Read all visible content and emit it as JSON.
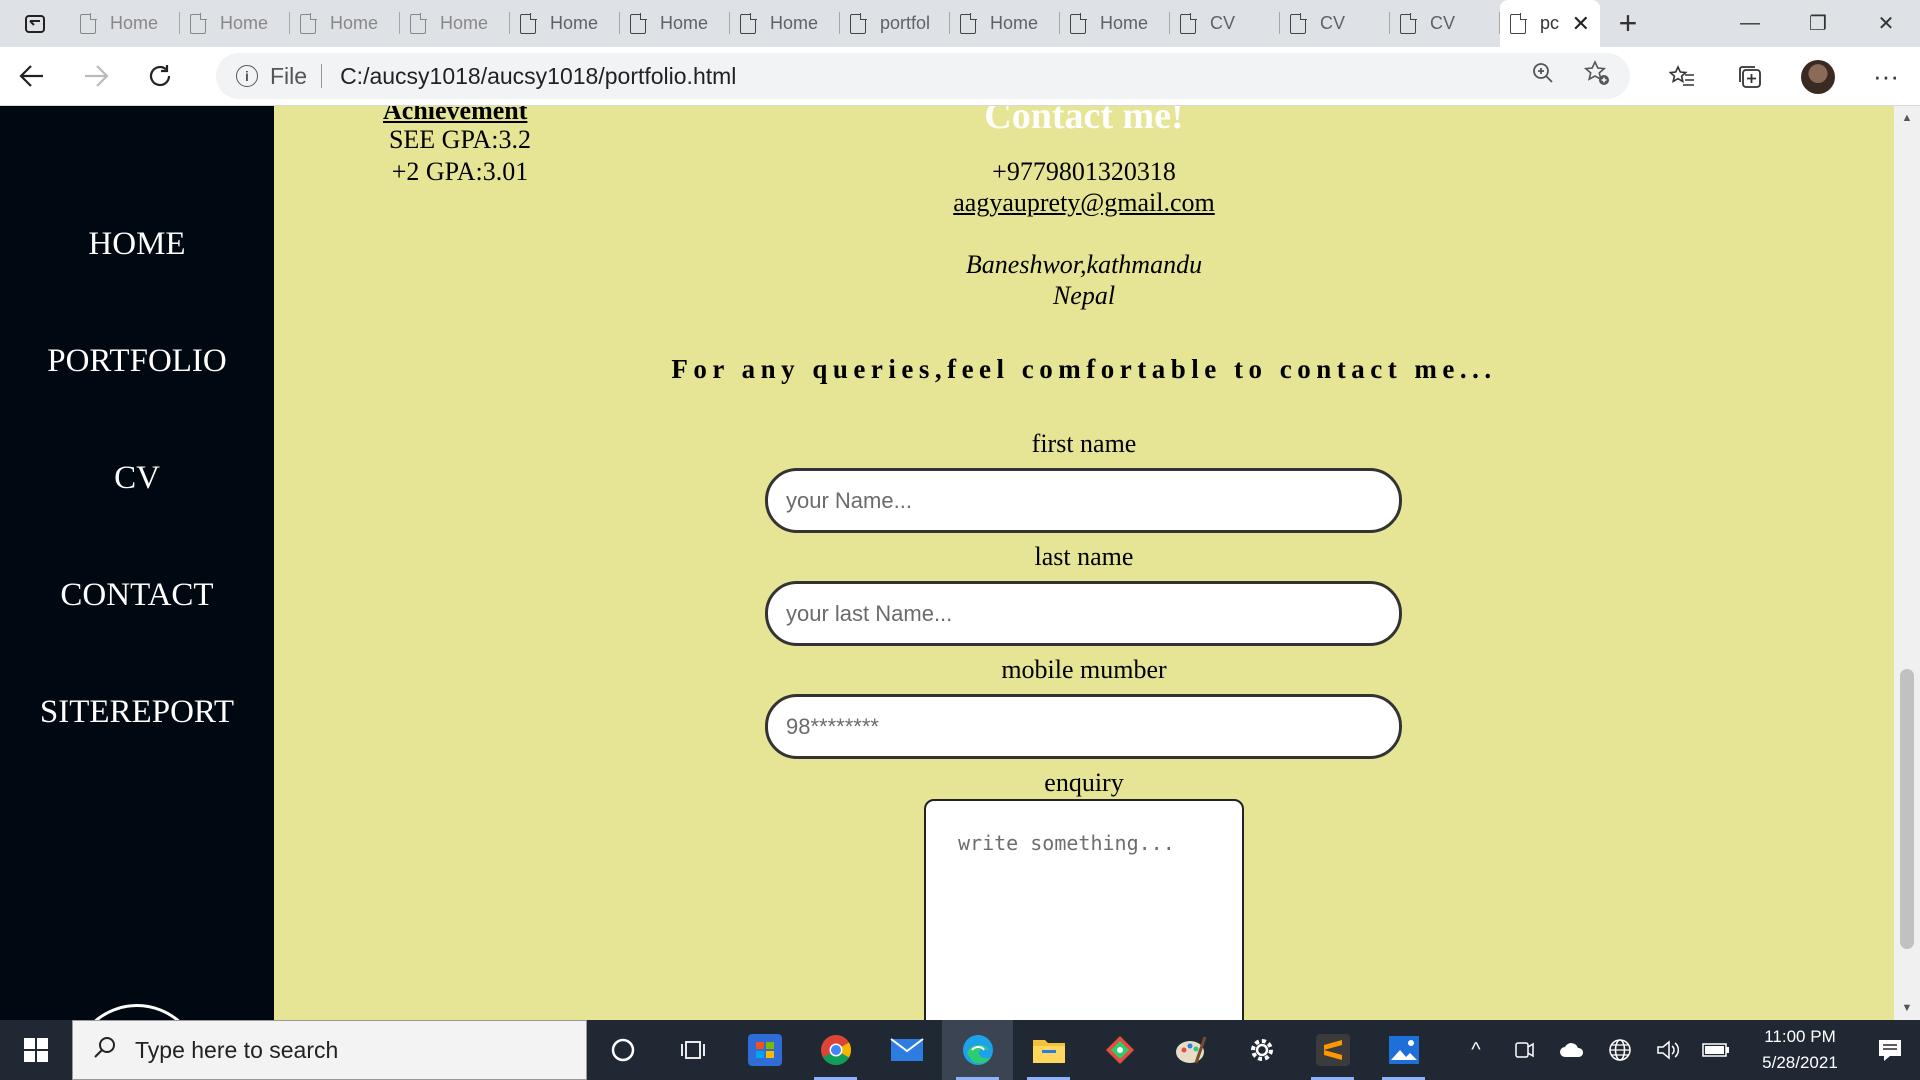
{
  "browser": {
    "tabs": [
      {
        "label": "Home",
        "dim": true
      },
      {
        "label": "Home",
        "dim": true
      },
      {
        "label": "Home",
        "dim": true
      },
      {
        "label": "Home",
        "dim": true
      },
      {
        "label": "Home",
        "dim": false
      },
      {
        "label": "Home",
        "dim": false
      },
      {
        "label": "Home",
        "dim": false
      },
      {
        "label": "portfol",
        "dim": false
      },
      {
        "label": "Home",
        "dim": false
      },
      {
        "label": "Home",
        "dim": false
      },
      {
        "label": "CV",
        "dim": false
      },
      {
        "label": "CV",
        "dim": false
      },
      {
        "label": "CV",
        "dim": false
      }
    ],
    "active_tab_label": "pc",
    "address": {
      "scheme_label": "File",
      "url": "C:/aucsy1018/aucsy1018/portfolio.html"
    }
  },
  "sidebar": {
    "items": [
      {
        "label": "HOME"
      },
      {
        "label": "PORTFOLIO"
      },
      {
        "label": "CV"
      },
      {
        "label": "CONTACT"
      },
      {
        "label": "SITEREPORT"
      }
    ]
  },
  "achievement": {
    "heading": "Achievement",
    "lines": [
      "SEE GPA:3.2",
      "+2 GPA:3.01"
    ]
  },
  "contact": {
    "heading": "Contact me!",
    "phone": "+9779801320318",
    "email": "aagyauprety@gmail.com",
    "address_line1": "Baneshwor,kathmandu",
    "address_line2": "Nepal"
  },
  "queries_text": "For any queries,feel comfortable to contact me...",
  "form": {
    "first_name": {
      "label": "first name",
      "placeholder": "your Name..."
    },
    "last_name": {
      "label": "last name",
      "placeholder": "your last Name..."
    },
    "mobile": {
      "label": "mobile mumber",
      "placeholder": "98********"
    },
    "enquiry": {
      "label": "enquiry",
      "placeholder": "write something..."
    }
  },
  "taskbar": {
    "search_placeholder": "Type here to search",
    "time": "11:00 PM",
    "date": "5/28/2021",
    "apps": [
      "cortana-icon",
      "task-view-icon",
      "store-icon",
      "chrome-icon",
      "mail-icon",
      "edge-icon",
      "file-explorer-icon",
      "snip-icon",
      "paint-icon",
      "settings-icon",
      "sublime-text-icon",
      "photos-icon"
    ]
  }
}
